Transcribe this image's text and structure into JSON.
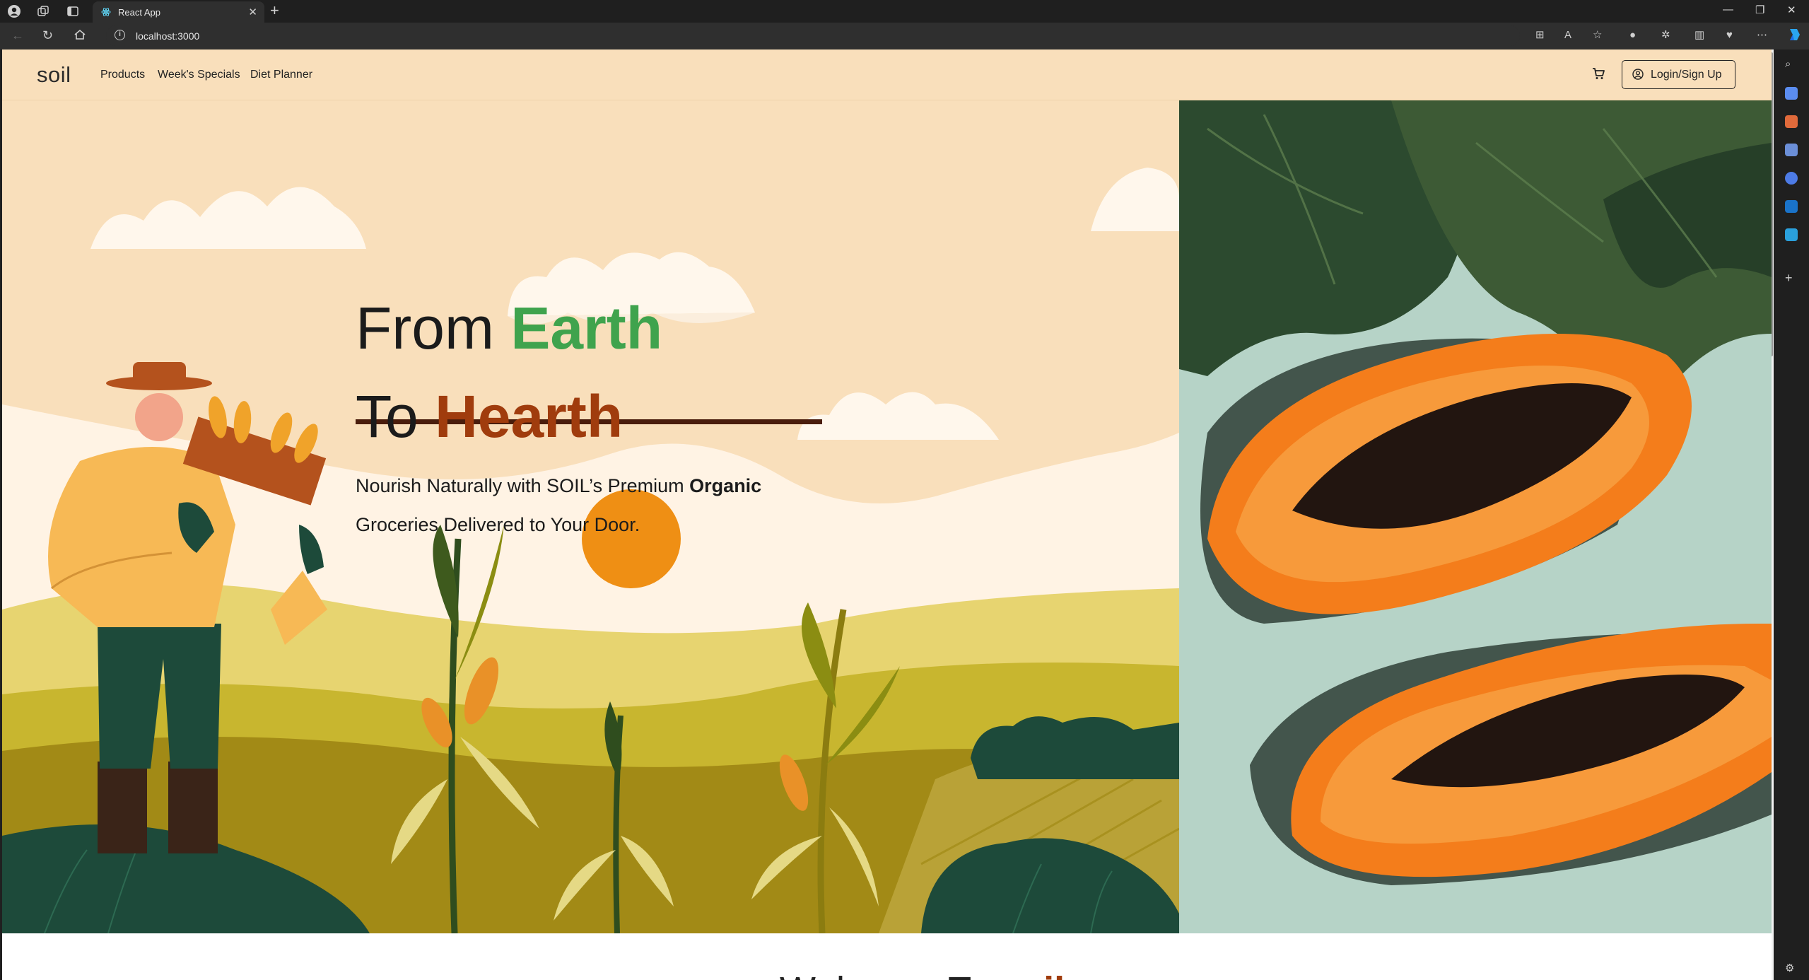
{
  "browser": {
    "tab_title": "React App",
    "url": "localhost:3000"
  },
  "navbar": {
    "brand": "soil",
    "links": [
      "Products",
      "Week's Specials",
      "Diet Planner"
    ],
    "login_label": "Login/Sign Up"
  },
  "hero": {
    "line1_prefix": "From",
    "line1_accent": "Earth",
    "line2_prefix": "To",
    "line2_accent": "Hearth",
    "sub_line1_prefix": "Nourish Naturally with SOIL’s Premium",
    "sub_line1_bold": "Organic",
    "sub_line2": "Groceries Delivered to Your Door."
  },
  "welcome": {
    "prefix": "Welcome To",
    "accent": "soil"
  },
  "colors": {
    "navbar_bg": "#f9dfbb",
    "accent_green": "#3fa34d",
    "accent_rust": "#a03c0d",
    "divider": "#4a1d0c"
  }
}
